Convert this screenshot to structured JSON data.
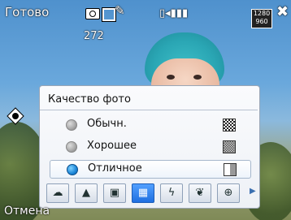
{
  "status_bar": {
    "ready_label": "Готово",
    "shots_remaining": "272",
    "resolution_badge": "1280 960",
    "close_glyph": "✖"
  },
  "bottom_bar": {
    "cancel_label": "Отмена"
  },
  "quality_popup": {
    "title": "Качество фото",
    "options": [
      {
        "label": "Обычн.",
        "selected": false,
        "icon": "quality-basic-icon"
      },
      {
        "label": "Хорошее",
        "selected": false,
        "icon": "quality-good-icon"
      },
      {
        "label": "Отличное",
        "selected": true,
        "icon": "quality-best-icon"
      }
    ],
    "toolbar": [
      {
        "icon": "scene-mode-icon",
        "glyph": "☁"
      },
      {
        "icon": "landscape-icon",
        "glyph": "▲"
      },
      {
        "icon": "frame-icon",
        "glyph": "▣"
      },
      {
        "icon": "quality-icon",
        "glyph": "▦"
      },
      {
        "icon": "flash-icon",
        "glyph": "ϟ"
      },
      {
        "icon": "macro-icon",
        "glyph": "❦"
      },
      {
        "icon": "zoom-icon",
        "glyph": "⊕"
      }
    ],
    "active_tool_index": 3
  },
  "colors": {
    "accent": "#1f6fe0",
    "panel_bg": "#f2f5f9"
  }
}
